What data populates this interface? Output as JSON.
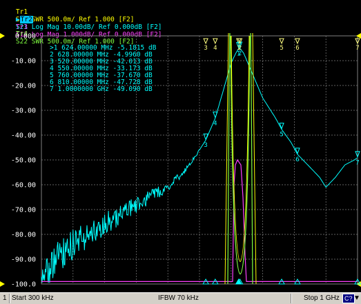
{
  "traces": [
    {
      "id": "Tr1",
      "text": "S11 SWR 500.0m/ Ref 1.000 [F2]",
      "color": "#ffff00",
      "active": false
    },
    {
      "id": "Tr2",
      "text": "S21 Log Mag 10.00dB/ Ref 0.000dB [F2]",
      "color": "#00ffff",
      "active": true
    },
    {
      "id": "Tr3",
      "text": "S12 Log Mag 1.000dB/ Ref 0.000dB [F2]",
      "color": "#ff40ff",
      "active": false
    },
    {
      "id": "Tr4",
      "text": "S22 SWR 500.0m/ Ref 1.000 [F2]",
      "color": "#80ff40",
      "active": false
    }
  ],
  "colors": {
    "grid": "#808080",
    "active_trace": "#00ffff",
    "s11": "#ffff00",
    "s12": "#ff40ff",
    "s22": "#80ff40",
    "marker": "#ffff80",
    "scale": "#ffffff"
  },
  "y_labels": [
    "0.000",
    "-10.00",
    "-20.00",
    "-30.00",
    "-40.00",
    "-50.00",
    "-60.00",
    "-70.00",
    "-80.00",
    "-90.00",
    "-100.0"
  ],
  "markers": [
    {
      "num": "1",
      "active": true,
      "freq": "624.00000 MHz",
      "val": "-5.1815 dB"
    },
    {
      "num": "2",
      "active": false,
      "freq": "628.00000 MHz",
      "val": "-4.9960 dB"
    },
    {
      "num": "3",
      "active": false,
      "freq": "520.00000 MHz",
      "val": "-42.013 dB"
    },
    {
      "num": "4",
      "active": false,
      "freq": "550.00000 MHz",
      "val": "-33.173 dB"
    },
    {
      "num": "5",
      "active": false,
      "freq": "760.00000 MHz",
      "val": "-37.670 dB"
    },
    {
      "num": "6",
      "active": false,
      "freq": "810.00000 MHz",
      "val": "-47.728 dB"
    },
    {
      "num": "7",
      "active": false,
      "freq": "1.0000000 GHz",
      "val": "-49.090 dB"
    }
  ],
  "chart_data": {
    "type": "line",
    "x_unit": "MHz",
    "xlim": [
      0.3,
      1000
    ],
    "ylim": [
      -100,
      0
    ],
    "series": [
      {
        "name": "S21",
        "points": [
          [
            0.3,
            -100
          ],
          [
            50,
            -90
          ],
          [
            100,
            -84
          ],
          [
            200,
            -76
          ],
          [
            300,
            -68
          ],
          [
            400,
            -61
          ],
          [
            450,
            -55
          ],
          [
            500,
            -46
          ],
          [
            520,
            -42.013
          ],
          [
            550,
            -33.173
          ],
          [
            580,
            -20
          ],
          [
            600,
            -11
          ],
          [
            615,
            -7
          ],
          [
            624,
            -5.1815
          ],
          [
            628,
            -4.996
          ],
          [
            640,
            -7
          ],
          [
            660,
            -13
          ],
          [
            700,
            -25
          ],
          [
            740,
            -33
          ],
          [
            760,
            -37.67
          ],
          [
            790,
            -43
          ],
          [
            810,
            -47.728
          ],
          [
            850,
            -53
          ],
          [
            880,
            -57
          ],
          [
            900,
            -61
          ],
          [
            930,
            -57
          ],
          [
            960,
            -52
          ],
          [
            990,
            -50
          ],
          [
            1000,
            -49.09
          ]
        ]
      }
    ]
  },
  "footer": {
    "index": "1",
    "start": "Start 300 kHz",
    "ifbw": "IFBW 70 kHz",
    "stop": "Stop 1 GHz",
    "c_label": "C?"
  }
}
